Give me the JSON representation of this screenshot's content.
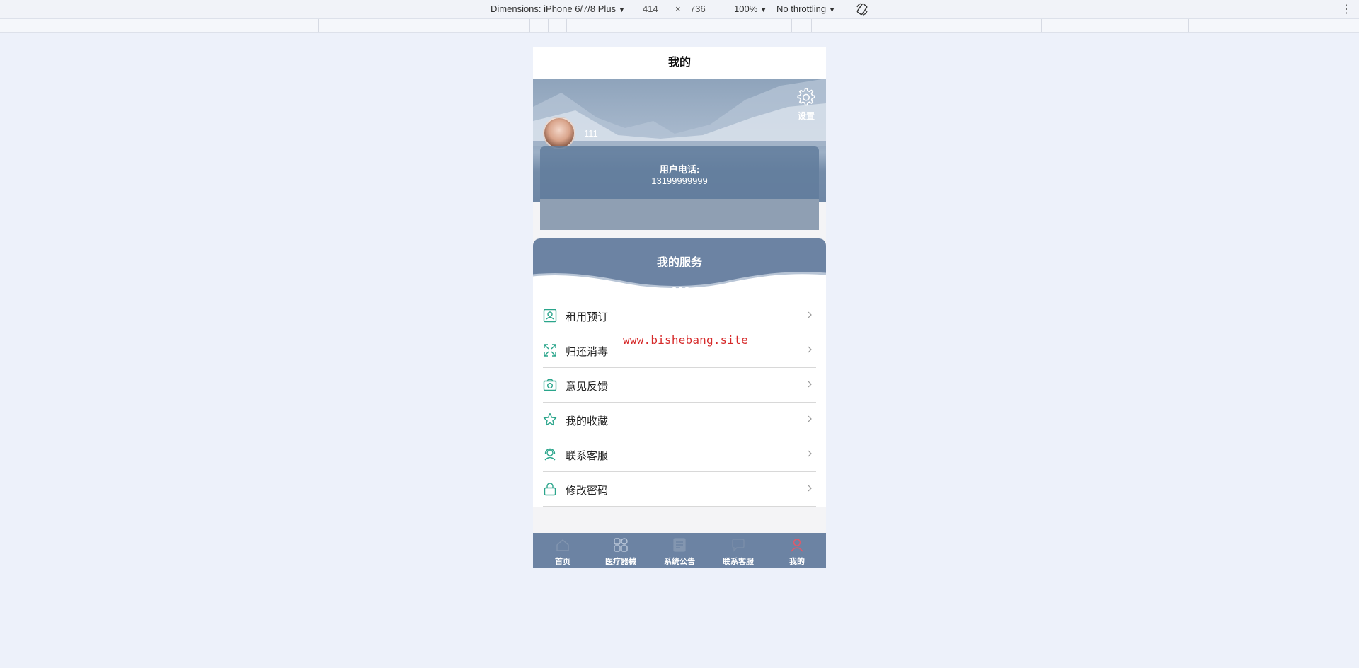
{
  "devtools": {
    "device_label": "Dimensions: iPhone 6/7/8 Plus",
    "width": "414",
    "times": "×",
    "height": "736",
    "zoom": "100%",
    "throttling": "No throttling"
  },
  "page": {
    "title": "我的"
  },
  "profile": {
    "username": "111",
    "settings_label": "设置",
    "phone_label": "用户电话:",
    "phone_value": "13199999999"
  },
  "services": {
    "title": "我的服务",
    "items": [
      {
        "label": "租用预订",
        "icon": "id-card-icon"
      },
      {
        "label": "归还消毒",
        "icon": "expand-arrows-icon"
      },
      {
        "label": "意见反馈",
        "icon": "camera-icon"
      },
      {
        "label": "我的收藏",
        "icon": "star-icon"
      },
      {
        "label": "联系客服",
        "icon": "support-agent-icon"
      },
      {
        "label": "修改密码",
        "icon": "lock-icon"
      }
    ]
  },
  "watermark": "www.bishebang.site",
  "tabbar": {
    "items": [
      {
        "label": "首页",
        "icon": "home-icon"
      },
      {
        "label": "医疗器械",
        "icon": "grid-icon"
      },
      {
        "label": "系统公告",
        "icon": "notice-icon"
      },
      {
        "label": "联系客服",
        "icon": "chat-icon"
      },
      {
        "label": "我的",
        "icon": "user-icon",
        "active": true
      }
    ]
  },
  "colors": {
    "accent": "#6c83a3",
    "icon_teal": "#2aa58b",
    "active_tab_icon": "#e05a6a"
  }
}
